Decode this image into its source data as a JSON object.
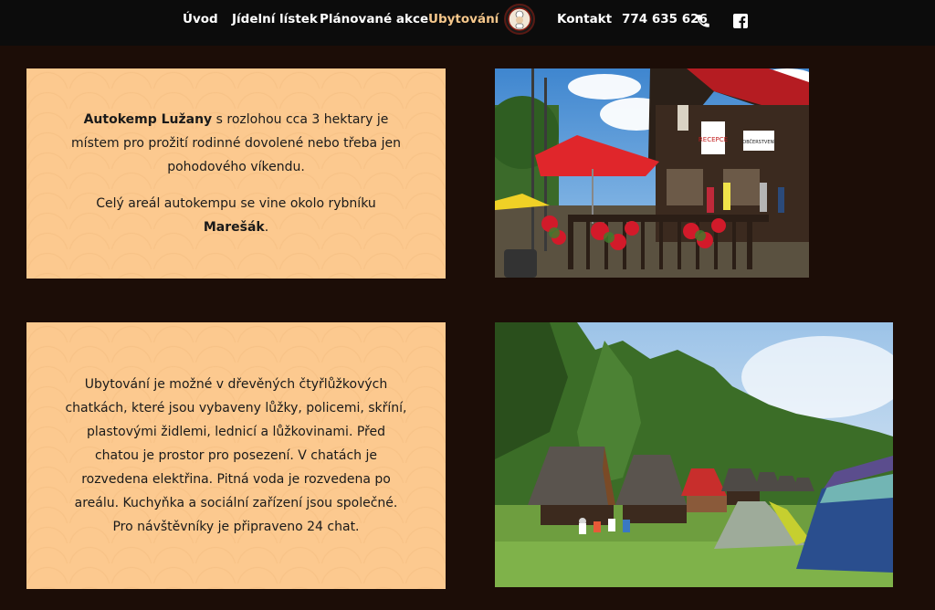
{
  "nav": {
    "items": [
      {
        "label": "Úvod"
      },
      {
        "label": "Jídelní lístek"
      },
      {
        "label": "Plánované akce"
      },
      {
        "label": "Ubytování",
        "active": true
      },
      {
        "label": "Kontakt"
      }
    ],
    "phone": "774 635 626",
    "phone_icon": "phone-icon",
    "social_icon": "facebook-icon",
    "active_color": "#f6c78b"
  },
  "section1": {
    "text": {
      "brand": "Autokemp Lužany",
      "line1_rest": " s rozlohou cca 3 hektary je místem pro prožití rodinné dovolené nebo třeba jen pohodového víkendu.",
      "line2_start": "Celý areál autokempu se vine okolo rybníku ",
      "pond": "Marešák",
      "line2_end": "."
    }
  },
  "section2": {
    "text": "Ubytování je možné v dřevěných čtyřlůžkových chatkách, které jsou vybaveny lůžky, policemi, skříní, plastovými židlemi, lednicí a lůžkovinami. Před chatou je prostor pro posezení. V chatách je rozvedena elektřina. Pitná voda je rozvedena po areálu. Kuchyňka a sociální zařízení jsou společné. Pro návštěvníky je připraveno 24 chat."
  },
  "photo1": {
    "sign_reception": "RECEPCE",
    "sign_board": "OBČERSTVENÍ"
  },
  "colors": {
    "background": "#1c0d07",
    "card": "#fcc98f",
    "topbar": "#0c0c0c"
  }
}
